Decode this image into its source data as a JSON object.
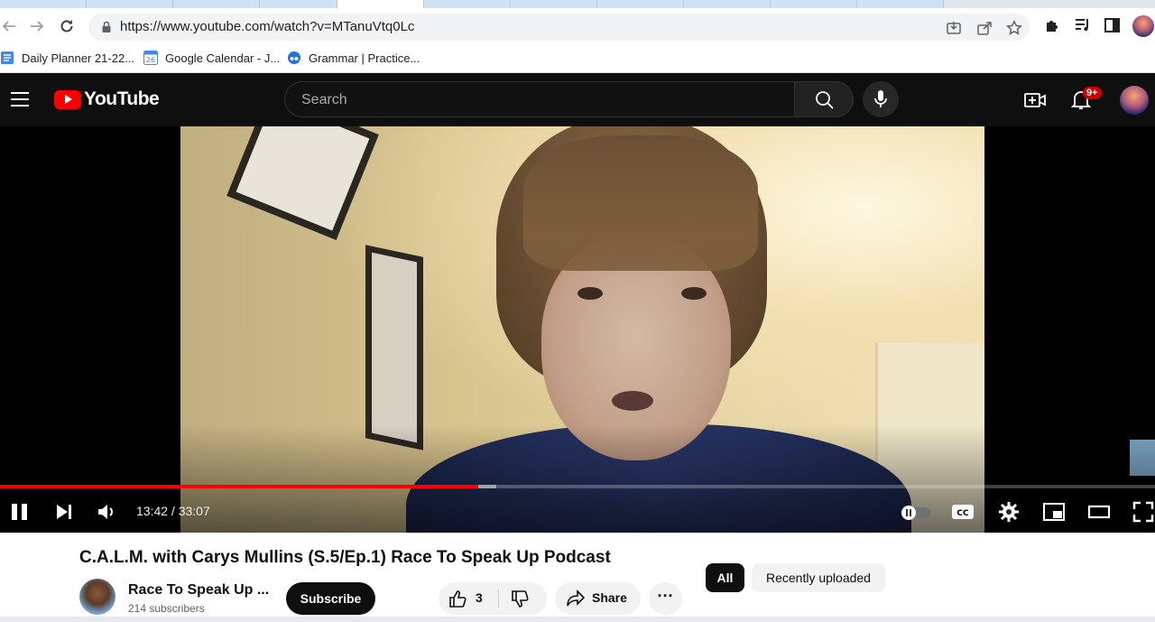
{
  "browser": {
    "url": "https://www.youtube.com/watch?v=MTanuVtq0Lc",
    "bookmarks": [
      {
        "label": "Daily Planner 21-22..."
      },
      {
        "label": "Google Calendar - J..."
      },
      {
        "label": "Grammar | Practice..."
      }
    ],
    "calendar_icon_day": "26"
  },
  "youtube": {
    "logo_text": "YouTube",
    "search_placeholder": "Search",
    "notification_badge": "9+"
  },
  "player": {
    "current_time": "13:42",
    "duration": "33:07",
    "time_display": "13:42 / 33:07",
    "played_fraction": 0.4142,
    "buffered_fraction": 0.43,
    "cc_label": "CC"
  },
  "video": {
    "title": "C.A.L.M. with Carys Mullins (S.5/Ep.1) Race To Speak Up Podcast",
    "channel_name": "Race To Speak Up ...",
    "subscribers": "214 subscribers",
    "subscribe_label": "Subscribe",
    "like_count": "3",
    "share_label": "Share",
    "more_label": "···"
  },
  "chips": [
    {
      "label": "All"
    },
    {
      "label": "Recently uploaded"
    }
  ],
  "colors": {
    "yt_red": "#ff0000",
    "header_bg": "#0f0f0f",
    "progress_red": "#ff0000"
  }
}
